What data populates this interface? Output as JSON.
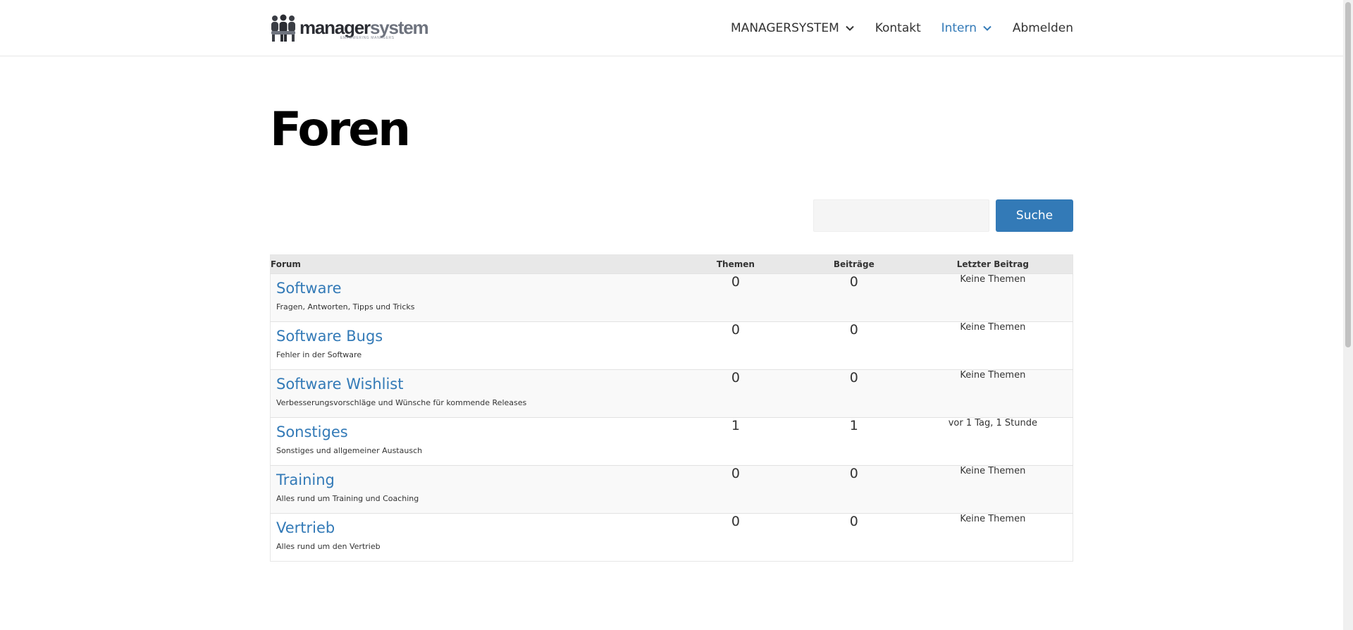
{
  "header": {
    "logo_dark": "manager",
    "logo_light": "system",
    "logo_tagline": "EMPOWERING MANAGERS",
    "nav": [
      {
        "label": "MANAGERSYSTEM",
        "dropdown": true,
        "active": false
      },
      {
        "label": "Kontakt",
        "dropdown": false,
        "active": false
      },
      {
        "label": "Intern",
        "dropdown": true,
        "active": true
      },
      {
        "label": "Abmelden",
        "dropdown": false,
        "active": false
      }
    ]
  },
  "page": {
    "title": "Foren"
  },
  "search": {
    "value": "",
    "placeholder": "",
    "button_label": "Suche"
  },
  "table": {
    "headers": {
      "forum": "Forum",
      "topics": "Themen",
      "posts": "Beiträge",
      "last_post": "Letzter Beitrag"
    },
    "rows": [
      {
        "name": "Software",
        "description": "Fragen, Antworten, Tipps und Tricks",
        "topics": "0",
        "posts": "0",
        "last_post": "Keine Themen"
      },
      {
        "name": "Software Bugs",
        "description": "Fehler in der Software",
        "topics": "0",
        "posts": "0",
        "last_post": "Keine Themen"
      },
      {
        "name": "Software Wishlist",
        "description": "Verbesserungsvorschläge und Wünsche für kommende Releases",
        "topics": "0",
        "posts": "0",
        "last_post": "Keine Themen"
      },
      {
        "name": "Sonstiges",
        "description": "Sonstiges und allgemeiner Austausch",
        "topics": "1",
        "posts": "1",
        "last_post": "vor 1 Tag, 1 Stunde"
      },
      {
        "name": "Training",
        "description": "Alles rund um Training und Coaching",
        "topics": "0",
        "posts": "0",
        "last_post": "Keine Themen"
      },
      {
        "name": "Vertrieb",
        "description": "Alles rund um den Vertrieb",
        "topics": "0",
        "posts": "0",
        "last_post": "Keine Themen"
      }
    ]
  },
  "colors": {
    "accent": "#337ab7",
    "header_row": "#e8e8e8",
    "row_bg": "#f9f9f9"
  }
}
